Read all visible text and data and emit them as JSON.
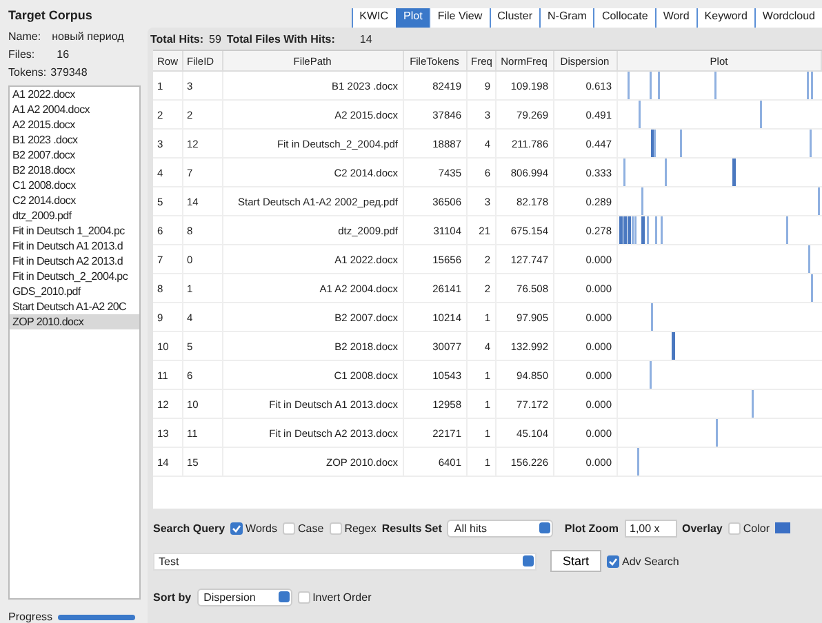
{
  "corpus": {
    "title": "Target Corpus",
    "name_label": "Name:",
    "name": "новый период",
    "files_label": "Files:",
    "files": "16",
    "tokens_label": "Tokens:",
    "tokens": "379348",
    "items": [
      {
        "label": "A1 2022.docx",
        "selected": false
      },
      {
        "label": "A1 A2 2004.docx",
        "selected": false
      },
      {
        "label": "A2 2015.docx",
        "selected": false
      },
      {
        "label": "B1 2023 .docx",
        "selected": false
      },
      {
        "label": "B2 2007.docx",
        "selected": false
      },
      {
        "label": "B2 2018.docx",
        "selected": false
      },
      {
        "label": "C1 2008.docx",
        "selected": false
      },
      {
        "label": "C2 2014.docx",
        "selected": false
      },
      {
        "label": "dtz_2009.pdf",
        "selected": false
      },
      {
        "label": "Fit in Deutsch 1_2004.pc",
        "selected": false
      },
      {
        "label": "Fit in Deutsch A1 2013.d",
        "selected": false
      },
      {
        "label": "Fit in Deutsch A2 2013.d",
        "selected": false
      },
      {
        "label": "Fit in Deutsch_2_2004.pc",
        "selected": false
      },
      {
        "label": "GDS_2010.pdf",
        "selected": false
      },
      {
        "label": "Start Deutsch A1-A2 20C",
        "selected": false
      },
      {
        "label": "ZOP 2010.docx",
        "selected": true
      }
    ]
  },
  "progress": {
    "label": "Progress",
    "level": 1
  },
  "tabs": [
    {
      "label": "KWIC",
      "selected": false
    },
    {
      "label": "Plot",
      "selected": true
    },
    {
      "label": "File View",
      "selected": false
    },
    {
      "label": "Cluster",
      "selected": false
    },
    {
      "label": "N-Gram",
      "selected": false
    },
    {
      "label": "Collocate",
      "selected": false
    },
    {
      "label": "Word",
      "selected": false
    },
    {
      "label": "Keyword",
      "selected": false
    },
    {
      "label": "Wordcloud",
      "selected": false
    }
  ],
  "summary": {
    "hits_label": "Total Hits:",
    "hits": "59",
    "files_label": "Total Files With Hits:",
    "files": "14"
  },
  "table": {
    "columns": [
      "Row",
      "FileID",
      "FilePath",
      "FileTokens",
      "Freq",
      "NormFreq",
      "Dispersion",
      "Plot"
    ],
    "rows": [
      [
        "1",
        "3",
        "B1 2023 .docx",
        "82419",
        "9",
        "109.198",
        "0.613"
      ],
      [
        "2",
        "2",
        "A2 2015.docx",
        "37846",
        "3",
        "79.269",
        "0.491"
      ],
      [
        "3",
        "12",
        "Fit in Deutsch_2_2004.pdf",
        "18887",
        "4",
        "211.786",
        "0.447"
      ],
      [
        "4",
        "7",
        "C2 2014.docx",
        "7435",
        "6",
        "806.994",
        "0.333"
      ],
      [
        "5",
        "14",
        "Start Deutsch A1-A2 2002_ред.pdf",
        "36506",
        "3",
        "82.178",
        "0.289"
      ],
      [
        "6",
        "8",
        "dtz_2009.pdf",
        "31104",
        "21",
        "675.154",
        "0.278"
      ],
      [
        "7",
        "0",
        "A1 2022.docx",
        "15656",
        "2",
        "127.747",
        "0.000"
      ],
      [
        "8",
        "1",
        "A1 A2 2004.docx",
        "26141",
        "2",
        "76.508",
        "0.000"
      ],
      [
        "9",
        "4",
        "B2 2007.docx",
        "10214",
        "1",
        "97.905",
        "0.000"
      ],
      [
        "10",
        "5",
        "B2 2018.docx",
        "30077",
        "4",
        "132.992",
        "0.000"
      ],
      [
        "11",
        "6",
        "C1 2008.docx",
        "10543",
        "1",
        "94.850",
        "0.000"
      ],
      [
        "12",
        "10",
        "Fit in Deutsch A1 2013.docx",
        "12958",
        "1",
        "77.172",
        "0.000"
      ],
      [
        "13",
        "11",
        "Fit in Deutsch A2 2013.docx",
        "22171",
        "1",
        "45.104",
        "0.000"
      ],
      [
        "14",
        "15",
        "ZOP 2010.docx",
        "6401",
        "1",
        "156.226",
        "0.000"
      ]
    ]
  },
  "controls": {
    "search_query": "Search Query",
    "options": [
      {
        "label": "Words",
        "checked": true
      },
      {
        "label": "Case",
        "checked": false
      },
      {
        "label": "Regex",
        "checked": false
      }
    ],
    "results_set_label": "Results Set",
    "results_set": "All hits",
    "plot_zoom_label": "Plot Zoom",
    "plot_zoom": "1,00 x",
    "overlay_label": "Overlay",
    "color_option": {
      "label": "Color",
      "checked": false
    },
    "query": "Test",
    "start": "Start",
    "adv_search": {
      "label": "Adv Search",
      "checked": true
    },
    "sort_by_label": "Sort by",
    "sort_by": "Dispersion",
    "invert_order": {
      "label": "Invert Order",
      "checked": false
    }
  }
}
